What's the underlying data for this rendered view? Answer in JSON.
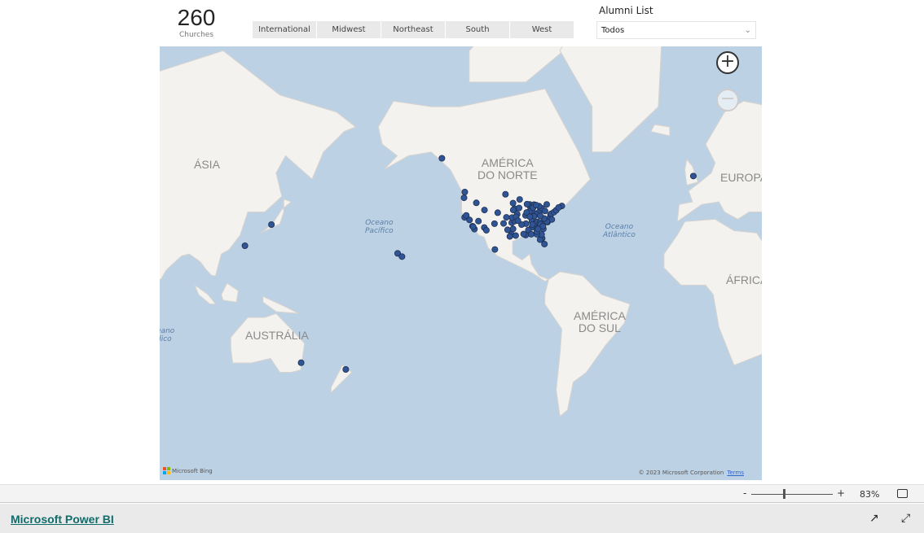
{
  "kpi": {
    "value": "260",
    "label": "Churches"
  },
  "region_slicer": [
    "International",
    "Midwest",
    "Northeast",
    "South",
    "West"
  ],
  "alumni": {
    "label": "Alumni List",
    "selected": "Todos"
  },
  "map": {
    "labels": {
      "asia": "ÁSIA",
      "north_america_1": "AMÉRICA",
      "north_america_2": "DO NORTE",
      "europe": "EUROPA",
      "africa": "ÁFRICA",
      "south_america_1": "AMÉRICA",
      "south_america_2": "DO SUL",
      "australia": "AUSTRÁLIA",
      "pacific_1": "Oceano",
      "pacific_2": "Pacífico",
      "atlantic_1": "Oceano",
      "atlantic_2": "Atlântico",
      "indian_1": "Oceano",
      "indian_2": "Índico"
    },
    "attribution": "Microsoft Bing",
    "copyright": "© 2023 Microsoft Corporation",
    "terms": "Terms",
    "point_color": "#2f5597",
    "points": [
      [
        -157.8,
        21.3
      ],
      [
        -155.5,
        19.7
      ],
      [
        -134.4,
        58.3
      ],
      [
        -1.5,
        53
      ],
      [
        135.5,
        34.7
      ],
      [
        121.5,
        25
      ],
      [
        151.2,
        -33.9
      ],
      [
        174.8,
        -36.8
      ],
      [
        -106.4,
        23.2
      ],
      [
        -122.4,
        37.8
      ],
      [
        -122.3,
        47.6
      ],
      [
        -122.7,
        45.5
      ],
      [
        -121.5,
        38.6
      ],
      [
        -118.2,
        34
      ],
      [
        -117.2,
        32.7
      ],
      [
        -117.9,
        33.8
      ],
      [
        -119.8,
        36.7
      ],
      [
        -112,
        33.4
      ],
      [
        -111.9,
        40.8
      ],
      [
        -104.9,
        39.7
      ],
      [
        -106.6,
        35.1
      ],
      [
        -116.2,
        43.6
      ],
      [
        -115.1,
        36.2
      ],
      [
        -110.9,
        32.2
      ],
      [
        -97.7,
        30.3
      ],
      [
        -96.8,
        32.8
      ],
      [
        -95.4,
        29.8
      ],
      [
        -98.5,
        29.4
      ],
      [
        -97.5,
        35.5
      ],
      [
        -95.9,
        36.2
      ],
      [
        -94.6,
        39.1
      ],
      [
        -93.3,
        44.9
      ],
      [
        -90.2,
        38.6
      ],
      [
        -87.6,
        41.9
      ],
      [
        -86.2,
        39.8
      ],
      [
        -83,
        40
      ],
      [
        -84.5,
        39.1
      ],
      [
        -81.7,
        41.5
      ],
      [
        -83,
        42.3
      ],
      [
        -85.7,
        38.2
      ],
      [
        -86.8,
        36.2
      ],
      [
        -90,
        35.1
      ],
      [
        -86.8,
        33.5
      ],
      [
        -84.4,
        33.7
      ],
      [
        -81.4,
        28.5
      ],
      [
        -80.2,
        25.8
      ],
      [
        -82.5,
        27.9
      ],
      [
        -81.7,
        30.3
      ],
      [
        -80.8,
        35.2
      ],
      [
        -78.6,
        35.8
      ],
      [
        -77.4,
        37.5
      ],
      [
        -77,
        38.9
      ],
      [
        -76.6,
        39.3
      ],
      [
        -75.2,
        39.9
      ],
      [
        -74,
        40.7
      ],
      [
        -79.9,
        40.4
      ],
      [
        -80.8,
        32.8
      ],
      [
        -90.1,
        30
      ],
      [
        -91.2,
        30.5
      ],
      [
        -92.3,
        34.7
      ],
      [
        -88,
        43
      ],
      [
        -89.4,
        43.1
      ],
      [
        -96,
        41.3
      ],
      [
        -96.7,
        40.8
      ],
      [
        -93.6,
        41.6
      ],
      [
        -97.3,
        37.7
      ],
      [
        -85.3,
        35
      ],
      [
        -83.9,
        35.9
      ],
      [
        -82.6,
        35.6
      ],
      [
        -79,
        43
      ],
      [
        -71,
        42.4
      ],
      [
        -72.7,
        41.8
      ],
      [
        -88.2,
        40.1
      ],
      [
        -89.6,
        39.8
      ],
      [
        -87.9,
        38
      ],
      [
        -86.5,
        34.7
      ],
      [
        -88.7,
        32.3
      ],
      [
        -84.3,
        30.4
      ],
      [
        -82.3,
        34.8
      ],
      [
        -81,
        34
      ],
      [
        -76.3,
        36.9
      ],
      [
        -85.7,
        42.9
      ],
      [
        -86.2,
        41.7
      ],
      [
        -84.6,
        42.7
      ],
      [
        -95.2,
        38
      ],
      [
        -94.2,
        36.4
      ],
      [
        -100.3,
        37.8
      ],
      [
        -99.7,
        32.4
      ],
      [
        -101.8,
        35.2
      ],
      [
        -100.8,
        46.8
      ],
      [
        -96.8,
        43.5
      ],
      [
        -78.9,
        36
      ],
      [
        -80.3,
        37.3
      ],
      [
        -82.4,
        38.4
      ],
      [
        -84.2,
        31.6
      ],
      [
        -83.6,
        32.8
      ],
      [
        -87.2,
        30.4
      ]
    ]
  },
  "zoom": {
    "minus": "-",
    "plus": "+",
    "percent": "83%",
    "level": 0.4
  },
  "footer": {
    "brand": "Microsoft Power BI"
  }
}
